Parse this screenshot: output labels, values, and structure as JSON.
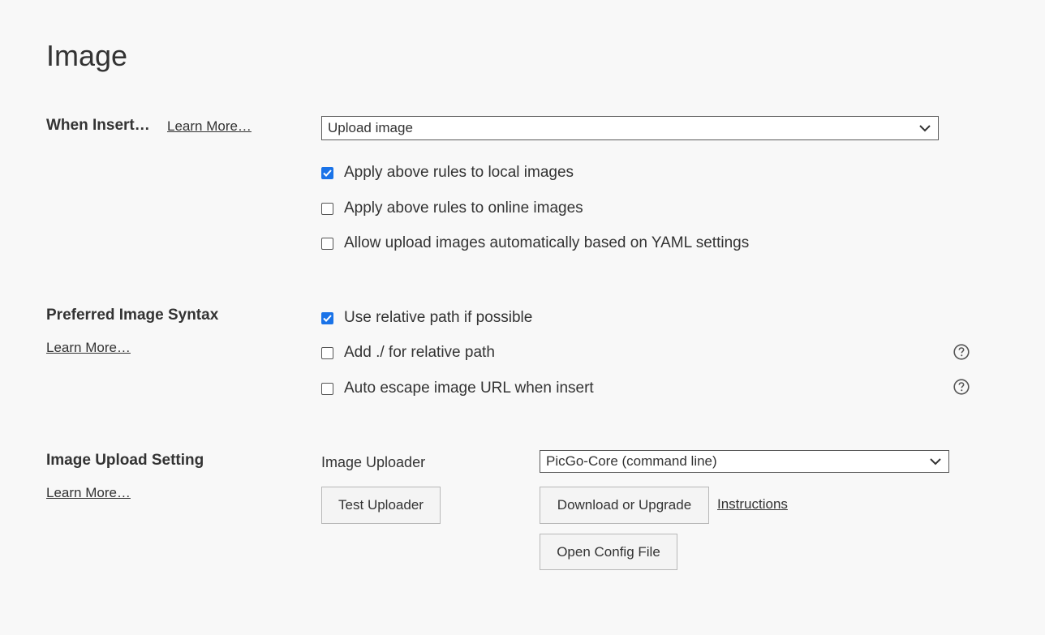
{
  "page": {
    "title": "Image"
  },
  "when_insert": {
    "label": "When Insert…",
    "learn_more": "Learn More…",
    "select_value": "Upload image",
    "options": [
      {
        "label": "Apply above rules to local images",
        "checked": true
      },
      {
        "label": "Apply above rules to online images",
        "checked": false
      },
      {
        "label": "Allow upload images automatically based on YAML settings",
        "checked": false
      }
    ]
  },
  "syntax": {
    "label": "Preferred Image Syntax",
    "learn_more": "Learn More…",
    "options": [
      {
        "label": "Use relative path if possible",
        "checked": true
      },
      {
        "label": "Add ./ for relative path",
        "checked": false,
        "help_icon": "help-circle-icon"
      },
      {
        "label": "Auto escape image URL when insert",
        "checked": false,
        "help_icon": "help-circle-icon"
      }
    ]
  },
  "upload": {
    "label": "Image Upload Setting",
    "learn_more": "Learn More…",
    "uploader_label": "Image Uploader",
    "uploader_value": "PicGo-Core (command line)",
    "test_button": "Test Uploader",
    "download_button": "Download or Upgrade",
    "instructions_link": "Instructions",
    "open_config_button": "Open Config File"
  },
  "colors": {
    "accent": "#1a73e8",
    "background": "#f8f8f8",
    "text": "#333333"
  }
}
